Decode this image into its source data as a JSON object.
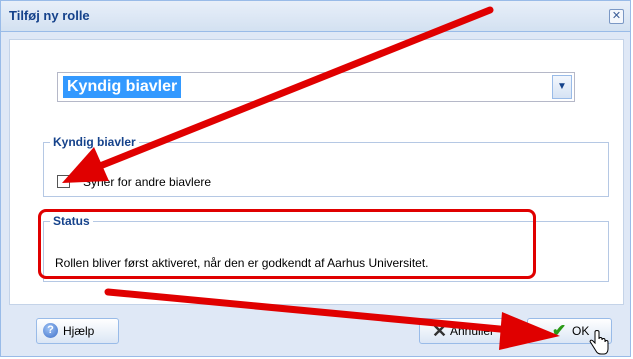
{
  "dialog": {
    "title": "Tilføj ny rolle",
    "close_glyph": "✕"
  },
  "role_select": {
    "value": "Kyndig biavler",
    "trigger_glyph": "▼"
  },
  "role_group": {
    "legend": "Kyndig biavler",
    "checkbox_label": "Syner for andre biavlere",
    "checkbox_checked": false
  },
  "status_group": {
    "legend": "Status",
    "text": "Rollen bliver først aktiveret, når den er godkendt af Aarhus Universitet."
  },
  "buttons": {
    "help": "Hjælp",
    "help_glyph": "?",
    "cancel": "Annuller",
    "cancel_glyph": "✕",
    "ok": "OK",
    "ok_glyph": "✔"
  },
  "icons": {
    "close": "close-icon",
    "help": "help-icon",
    "cancel": "x-icon",
    "ok": "check-icon",
    "cursor": "hand-pointer-icon"
  },
  "colors": {
    "annotation": "#e00000",
    "title": "#15428b",
    "selection": "#3399ff"
  }
}
